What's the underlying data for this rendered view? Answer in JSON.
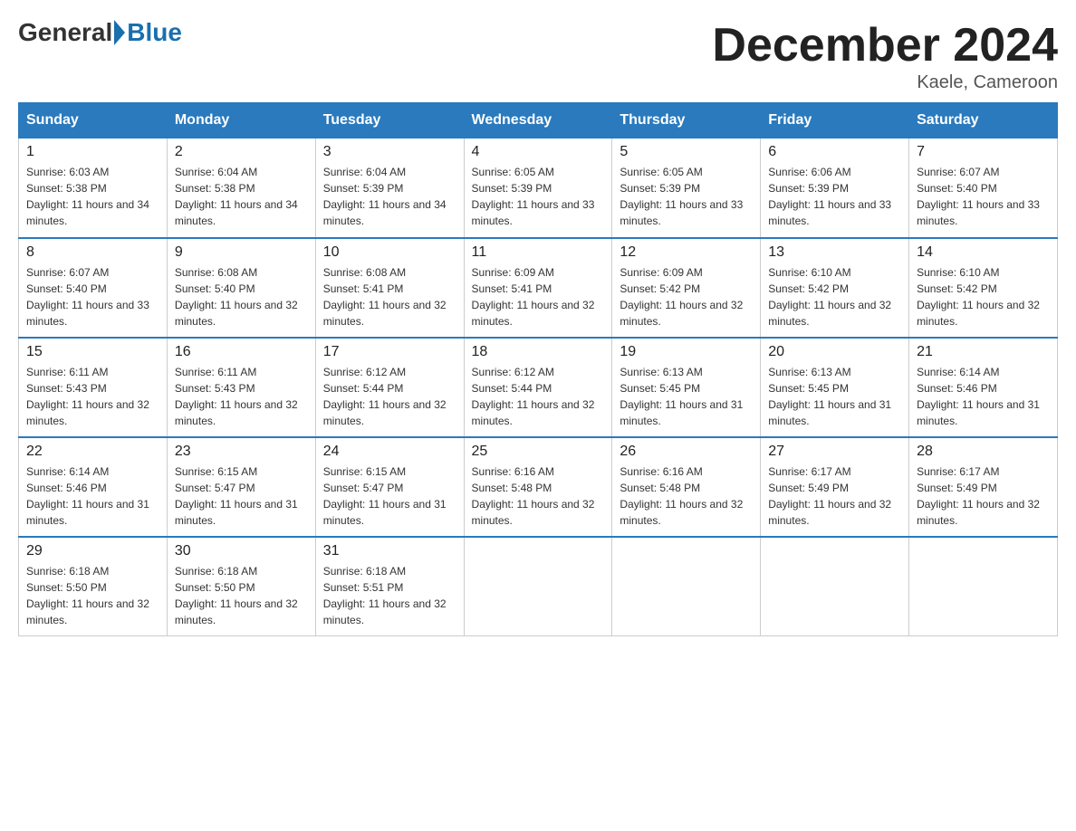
{
  "logo": {
    "general": "General",
    "blue": "Blue"
  },
  "title": "December 2024",
  "location": "Kaele, Cameroon",
  "days_of_week": [
    "Sunday",
    "Monday",
    "Tuesday",
    "Wednesday",
    "Thursday",
    "Friday",
    "Saturday"
  ],
  "weeks": [
    [
      {
        "day": "1",
        "sunrise": "6:03 AM",
        "sunset": "5:38 PM",
        "daylight": "11 hours and 34 minutes."
      },
      {
        "day": "2",
        "sunrise": "6:04 AM",
        "sunset": "5:38 PM",
        "daylight": "11 hours and 34 minutes."
      },
      {
        "day": "3",
        "sunrise": "6:04 AM",
        "sunset": "5:39 PM",
        "daylight": "11 hours and 34 minutes."
      },
      {
        "day": "4",
        "sunrise": "6:05 AM",
        "sunset": "5:39 PM",
        "daylight": "11 hours and 33 minutes."
      },
      {
        "day": "5",
        "sunrise": "6:05 AM",
        "sunset": "5:39 PM",
        "daylight": "11 hours and 33 minutes."
      },
      {
        "day": "6",
        "sunrise": "6:06 AM",
        "sunset": "5:39 PM",
        "daylight": "11 hours and 33 minutes."
      },
      {
        "day": "7",
        "sunrise": "6:07 AM",
        "sunset": "5:40 PM",
        "daylight": "11 hours and 33 minutes."
      }
    ],
    [
      {
        "day": "8",
        "sunrise": "6:07 AM",
        "sunset": "5:40 PM",
        "daylight": "11 hours and 33 minutes."
      },
      {
        "day": "9",
        "sunrise": "6:08 AM",
        "sunset": "5:40 PM",
        "daylight": "11 hours and 32 minutes."
      },
      {
        "day": "10",
        "sunrise": "6:08 AM",
        "sunset": "5:41 PM",
        "daylight": "11 hours and 32 minutes."
      },
      {
        "day": "11",
        "sunrise": "6:09 AM",
        "sunset": "5:41 PM",
        "daylight": "11 hours and 32 minutes."
      },
      {
        "day": "12",
        "sunrise": "6:09 AM",
        "sunset": "5:42 PM",
        "daylight": "11 hours and 32 minutes."
      },
      {
        "day": "13",
        "sunrise": "6:10 AM",
        "sunset": "5:42 PM",
        "daylight": "11 hours and 32 minutes."
      },
      {
        "day": "14",
        "sunrise": "6:10 AM",
        "sunset": "5:42 PM",
        "daylight": "11 hours and 32 minutes."
      }
    ],
    [
      {
        "day": "15",
        "sunrise": "6:11 AM",
        "sunset": "5:43 PM",
        "daylight": "11 hours and 32 minutes."
      },
      {
        "day": "16",
        "sunrise": "6:11 AM",
        "sunset": "5:43 PM",
        "daylight": "11 hours and 32 minutes."
      },
      {
        "day": "17",
        "sunrise": "6:12 AM",
        "sunset": "5:44 PM",
        "daylight": "11 hours and 32 minutes."
      },
      {
        "day": "18",
        "sunrise": "6:12 AM",
        "sunset": "5:44 PM",
        "daylight": "11 hours and 32 minutes."
      },
      {
        "day": "19",
        "sunrise": "6:13 AM",
        "sunset": "5:45 PM",
        "daylight": "11 hours and 31 minutes."
      },
      {
        "day": "20",
        "sunrise": "6:13 AM",
        "sunset": "5:45 PM",
        "daylight": "11 hours and 31 minutes."
      },
      {
        "day": "21",
        "sunrise": "6:14 AM",
        "sunset": "5:46 PM",
        "daylight": "11 hours and 31 minutes."
      }
    ],
    [
      {
        "day": "22",
        "sunrise": "6:14 AM",
        "sunset": "5:46 PM",
        "daylight": "11 hours and 31 minutes."
      },
      {
        "day": "23",
        "sunrise": "6:15 AM",
        "sunset": "5:47 PM",
        "daylight": "11 hours and 31 minutes."
      },
      {
        "day": "24",
        "sunrise": "6:15 AM",
        "sunset": "5:47 PM",
        "daylight": "11 hours and 31 minutes."
      },
      {
        "day": "25",
        "sunrise": "6:16 AM",
        "sunset": "5:48 PM",
        "daylight": "11 hours and 32 minutes."
      },
      {
        "day": "26",
        "sunrise": "6:16 AM",
        "sunset": "5:48 PM",
        "daylight": "11 hours and 32 minutes."
      },
      {
        "day": "27",
        "sunrise": "6:17 AM",
        "sunset": "5:49 PM",
        "daylight": "11 hours and 32 minutes."
      },
      {
        "day": "28",
        "sunrise": "6:17 AM",
        "sunset": "5:49 PM",
        "daylight": "11 hours and 32 minutes."
      }
    ],
    [
      {
        "day": "29",
        "sunrise": "6:18 AM",
        "sunset": "5:50 PM",
        "daylight": "11 hours and 32 minutes."
      },
      {
        "day": "30",
        "sunrise": "6:18 AM",
        "sunset": "5:50 PM",
        "daylight": "11 hours and 32 minutes."
      },
      {
        "day": "31",
        "sunrise": "6:18 AM",
        "sunset": "5:51 PM",
        "daylight": "11 hours and 32 minutes."
      },
      null,
      null,
      null,
      null
    ]
  ]
}
